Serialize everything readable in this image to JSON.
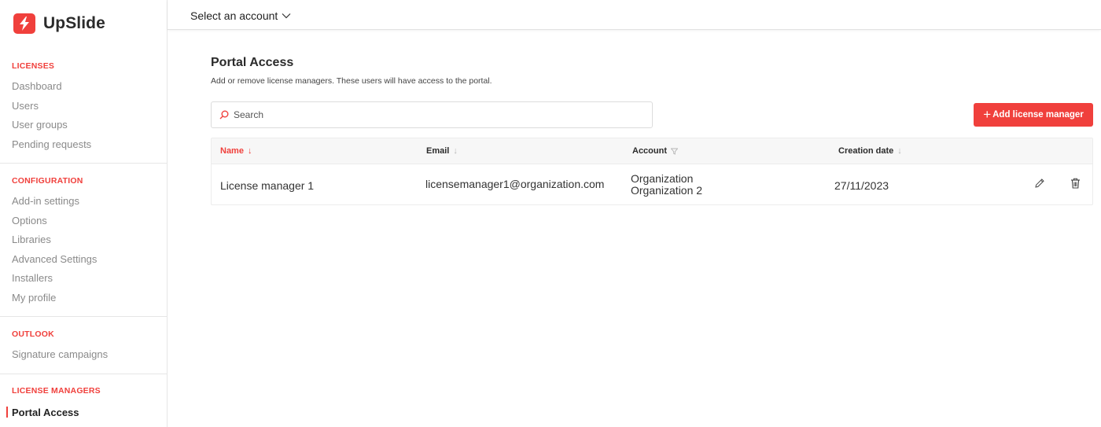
{
  "brand": {
    "name": "UpSlide",
    "color": "#f0403c"
  },
  "sidebar": {
    "sections": [
      {
        "title": "LICENSES",
        "items": [
          "Dashboard",
          "Users",
          "User groups",
          "Pending requests"
        ]
      },
      {
        "title": "CONFIGURATION",
        "items": [
          "Add-in settings",
          "Options",
          "Libraries",
          "Advanced Settings",
          "Installers",
          "My profile"
        ]
      },
      {
        "title": "OUTLOOK",
        "items": [
          "Signature campaigns"
        ]
      },
      {
        "title": "LICENSE MANAGERS",
        "items": [
          "Portal Access"
        ]
      }
    ],
    "active_item": "Portal Access"
  },
  "topbar": {
    "account_select_label": "Select an account"
  },
  "main": {
    "title": "Portal Access",
    "subtitle": "Add or remove license managers. These users will have access to the portal.",
    "search_placeholder": "Search",
    "add_button_label": "Add license manager",
    "table": {
      "columns": [
        {
          "label": "Name",
          "sort": "desc",
          "active": true
        },
        {
          "label": "Email",
          "sort": "desc",
          "active": false
        },
        {
          "label": "Account",
          "sort": "filter",
          "active": false
        },
        {
          "label": "Creation date",
          "sort": "desc",
          "active": false
        }
      ],
      "rows": [
        {
          "name": "License manager 1",
          "email": "licensemanager1@organization.com",
          "accounts": [
            "Organization",
            "Organization 2"
          ],
          "creation_date": "27/11/2023"
        }
      ]
    }
  },
  "icons": {
    "logo": "lightning-bolt-icon",
    "chevron": "chevron-down-icon",
    "search": "search-icon",
    "edit": "pencil-icon",
    "delete": "trash-icon"
  }
}
